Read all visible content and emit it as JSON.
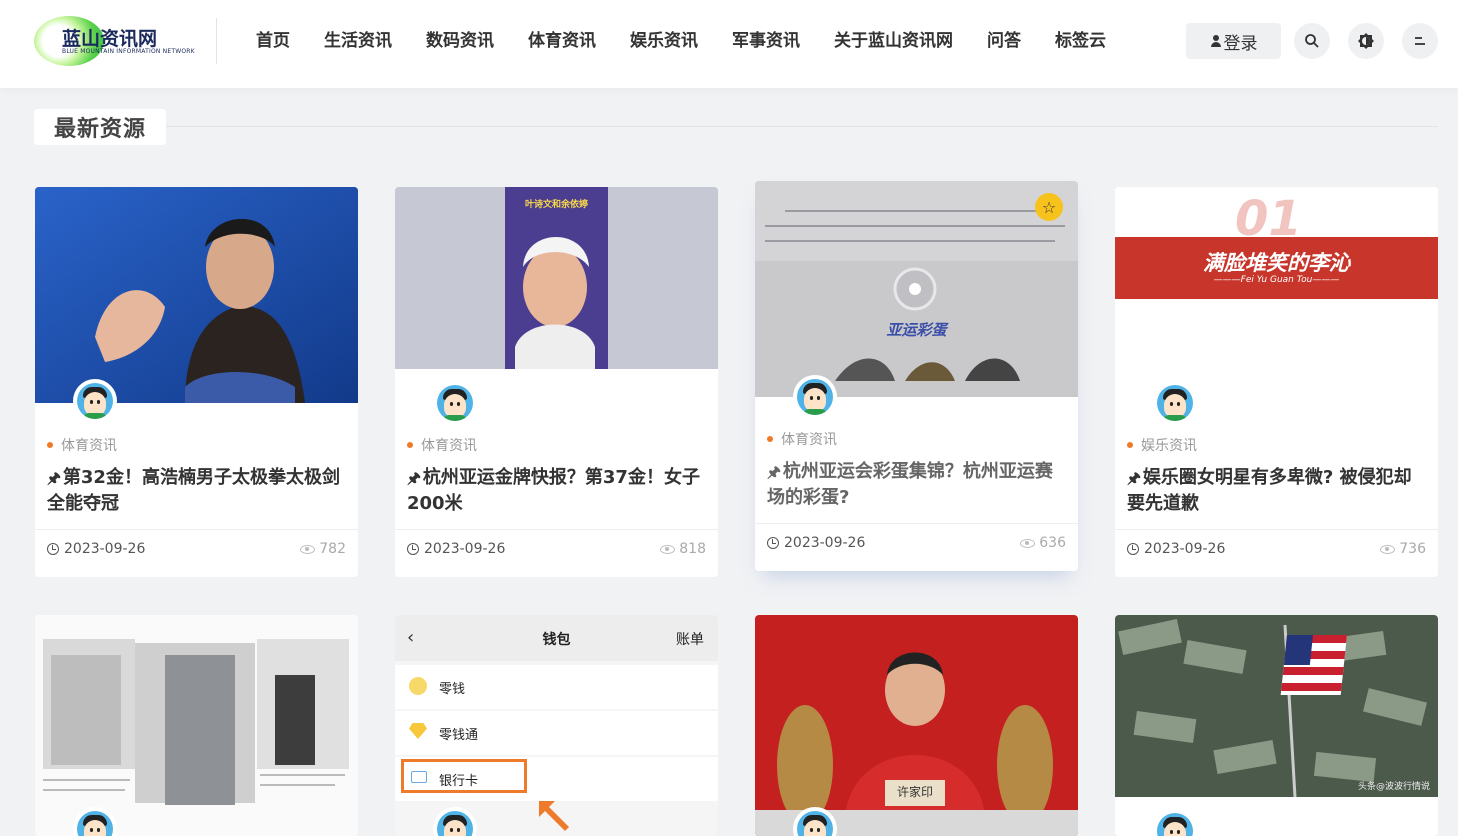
{
  "site": {
    "logo_text": "蓝山资讯网",
    "logo_subtitle": "BLUE MOUNTAIN INFORMATION NETWORK"
  },
  "nav": [
    {
      "label": "首页"
    },
    {
      "label": "生活资讯"
    },
    {
      "label": "数码资讯"
    },
    {
      "label": "体育资讯"
    },
    {
      "label": "娱乐资讯"
    },
    {
      "label": "军事资讯"
    },
    {
      "label": "关于蓝山资讯网"
    },
    {
      "label": "问答"
    },
    {
      "label": "标签云"
    }
  ],
  "header_actions": {
    "login_label": "登录",
    "search_icon": "search-icon",
    "theme_icon": "theme-toggle-icon",
    "menu_icon": "menu-icon"
  },
  "section": {
    "title": "最新资源"
  },
  "cards": [
    {
      "thumb_text": "",
      "category": "体育资讯",
      "title": "第32金！高浩楠男子太极拳太极剑全能夺冠",
      "date": "2023-09-26",
      "views": "782"
    },
    {
      "thumb_text": "叶诗文和余依婷",
      "category": "体育资讯",
      "title": "杭州亚运金牌快报？第37金！女子200米",
      "date": "2023-09-26",
      "views": "818"
    },
    {
      "thumb_text": "亚运彩蛋",
      "category": "体育资讯",
      "title": "杭州亚运会彩蛋集锦？杭州亚运赛场的彩蛋?",
      "date": "2023-09-26",
      "views": "636"
    },
    {
      "thumb_text": "满脸堆笑的李沁",
      "thumb_subtext": "———Fei Yu Guan Tou———",
      "category": "娱乐资讯",
      "title": "娱乐圈女明星有多卑微? 被侵犯却要先道歉",
      "date": "2023-09-26",
      "views": "736"
    }
  ],
  "cards_row2": [
    {
      "thumb_text": ""
    },
    {
      "wallet_title": "钱包",
      "wallet_right": "账单",
      "wallet_items": [
        "零钱",
        "零钱通",
        "银行卡"
      ]
    },
    {
      "thumb_text": "许家印"
    },
    {
      "thumb_text": "头条@波波行情说"
    }
  ],
  "colors": {
    "accent_dot": "#f07a25",
    "star_badge": "#f7c21c",
    "banner_red": "#c8352b"
  }
}
